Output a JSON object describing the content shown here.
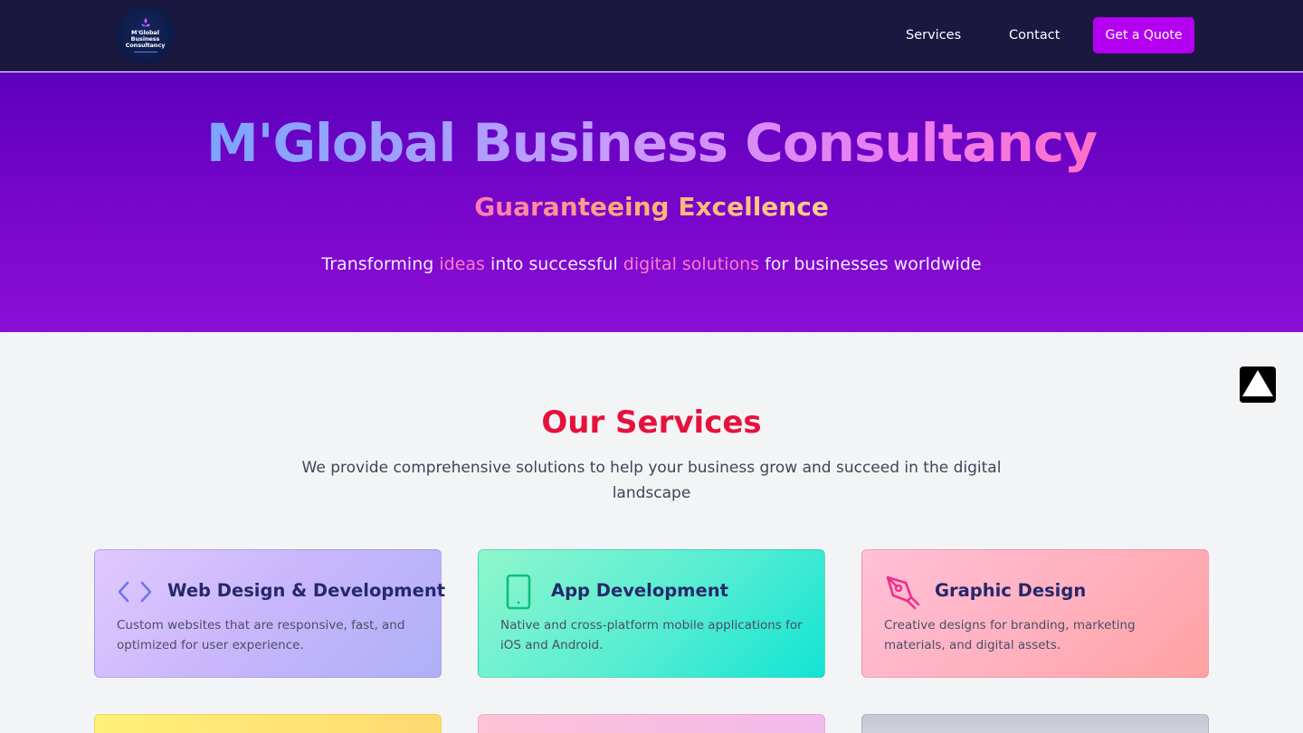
{
  "nav": {
    "logo_lines": [
      "M'Global",
      "Business",
      "Consultancy"
    ],
    "links": [
      "Services",
      "Contact"
    ],
    "cta_label": "Get a Quote"
  },
  "hero": {
    "title": "M'Global Business Consultancy",
    "tagline": "Guaranteeing Excellence",
    "subtitle_parts": [
      "Transforming ",
      "ideas",
      " into successful ",
      "digital solutions",
      " for businesses worldwide"
    ]
  },
  "services": {
    "title": "Our Services",
    "description": "We provide comprehensive solutions to help your business grow and succeed in the digital landscape",
    "cards": [
      {
        "icon": "code-icon",
        "title": "Web Design & Development",
        "description": "Custom websites that are responsive, fast, and optimized for user experience."
      },
      {
        "icon": "mobile-phone-icon",
        "title": "App Development",
        "description": "Native and cross-platform mobile applications for iOS and Android."
      },
      {
        "icon": "pen-tool-icon",
        "title": "Graphic Design",
        "description": "Creative designs for branding, marketing materials, and digital assets."
      }
    ]
  },
  "colors": {
    "nav_bg": "#1b1840",
    "cta_bg": "#b400f0",
    "hero_bg_top": "#5b00bb",
    "hero_bg_bottom": "#8b0fd6",
    "section_title": "#e5123d",
    "card_title": "#25286b",
    "highlight": "#ff7ac6"
  }
}
